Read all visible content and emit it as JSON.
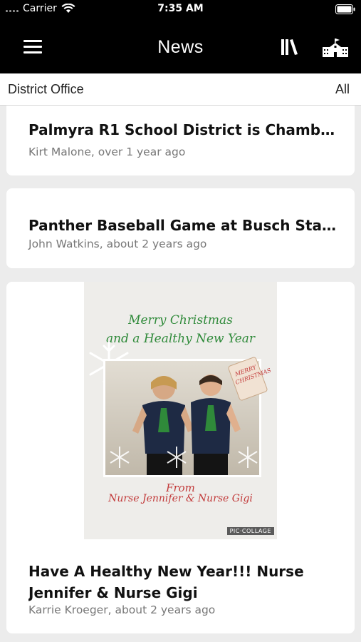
{
  "status_bar": {
    "carrier": "Carrier",
    "time": "7:35 AM"
  },
  "nav": {
    "title": "News",
    "left_icon": "menu-icon",
    "right_icons": [
      "library-icon",
      "school-icon"
    ]
  },
  "filter": {
    "left_label": "District Office",
    "right_label": "All"
  },
  "news": [
    {
      "title": "Palmyra R1 School District is Chamber...",
      "meta": "Kirt Malone, over 1 year ago"
    },
    {
      "title": "Panther Baseball Game at Busch Stadi...",
      "meta": "John Watkins, about 2 years ago"
    },
    {
      "title": "Have A Healthy New Year!!!  Nurse Jennifer & Nurse Gigi",
      "meta": "Karrie Kroeger, about 2 years ago",
      "image": {
        "greeting_line_1": "Merry Christmas",
        "greeting_line_2": "and a Healthy New Year",
        "tag_text": "MERRY CHRISTMAS",
        "from_text": "From",
        "signature": "Nurse Jennifer & Nurse Gigi",
        "watermark": "PIC·COLLAGE"
      }
    }
  ],
  "colors": {
    "nav_background": "#000000",
    "page_background": "#ececec",
    "card_background": "#ffffff",
    "meta_text": "#777777",
    "greeting_green": "#2f8a3a",
    "signature_red": "#c23a3a"
  }
}
